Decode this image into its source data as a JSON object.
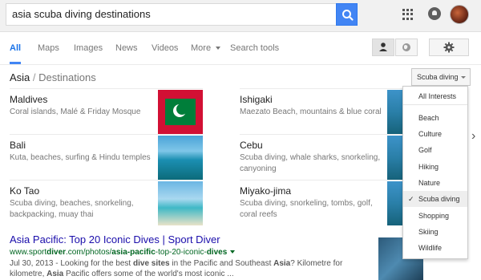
{
  "search": {
    "query": "asia scuba diving destinations"
  },
  "nav": {
    "tabs": [
      "All",
      "Maps",
      "Images",
      "News",
      "Videos",
      "More",
      "Search tools"
    ]
  },
  "breadcrumb": {
    "root": "Asia",
    "separator": "/",
    "current": "Destinations"
  },
  "interest_select": {
    "value": "Scuba diving"
  },
  "destinations": [
    {
      "name": "Maldives",
      "desc": "Coral islands, Malé & Friday Mosque"
    },
    {
      "name": "Ishigaki",
      "desc": "Maezato Beach, mountains & blue coral"
    },
    {
      "name": "Bali",
      "desc": "Kuta, beaches, surfing & Hindu temples"
    },
    {
      "name": "Cebu",
      "desc": "Scuba diving, whale sharks, snorkeling, canyoning"
    },
    {
      "name": "Ko Tao",
      "desc": "Scuba diving, beaches, snorkeling, backpacking, muay thai"
    },
    {
      "name": "Miyako-jima",
      "desc": "Scuba diving, snorkeling, tombs, golf, coral reefs"
    }
  ],
  "dropdown": {
    "items": [
      "All Interests",
      "Beach",
      "Culture",
      "Golf",
      "Hiking",
      "Nature",
      "Scuba diving",
      "Shopping",
      "Skiing",
      "Wildlife"
    ],
    "selected": "Scuba diving",
    "check": "✓"
  },
  "result": {
    "title": "Asia Pacific: Top 20 Iconic Dives | Sport Diver",
    "url_prefix": "www.sport",
    "url_bold1": "diver",
    "url_mid": ".com/photos/",
    "url_bold2": "asia-pacific",
    "url_mid2": "-top-20-iconic-",
    "url_bold3": "dives",
    "snippet_date": "Jul 30, 2013 - ",
    "snippet_a": "Looking for the best ",
    "snippet_b": "dive sites",
    "snippet_c": " in the Pacific and Southeast ",
    "snippet_d": "Asia",
    "snippet_e": "? Kilometre for kilometre, ",
    "snippet_f": "Asia",
    "snippet_g": " Pacific offers some of the world's most iconic ..."
  },
  "icons": {
    "search": "search-icon",
    "apps": "apps-grid-icon",
    "notifications": "notifications-icon",
    "settings": "gear-icon",
    "personal": "person-icon",
    "global": "globe-icon",
    "next": "chevron-right-icon"
  },
  "colors": {
    "accent": "#4285f4",
    "link": "#1a0dab",
    "url": "#006621"
  }
}
